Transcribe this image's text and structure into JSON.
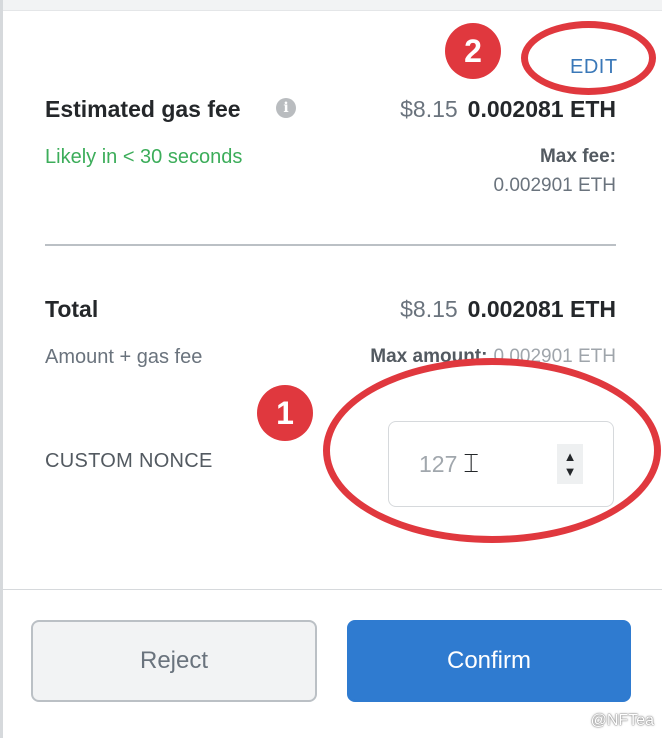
{
  "gas": {
    "edit_label": "EDIT",
    "label": "Estimated gas fee",
    "info_icon": "i",
    "fiat": "$8.15",
    "crypto": "0.002081 ETH",
    "likely": "Likely in < 30 seconds",
    "max_fee_label": "Max fee:",
    "max_fee_value": "0.002901 ETH"
  },
  "total": {
    "label": "Total",
    "fiat": "$8.15",
    "crypto": "0.002081 ETH",
    "sublabel": "Amount + gas fee",
    "max_amount_label": "Max amount:",
    "max_amount_value": "0.002901 ETH"
  },
  "nonce": {
    "label": "CUSTOM NONCE",
    "value": "127"
  },
  "buttons": {
    "reject": "Reject",
    "confirm": "Confirm"
  },
  "annotations": {
    "badge_1": "1",
    "badge_2": "2",
    "color": "#e0383e"
  },
  "watermark": "@NFTea",
  "colors": {
    "primary": "#2f7bd0",
    "success": "#3cad5a",
    "link": "#3a78b8"
  }
}
